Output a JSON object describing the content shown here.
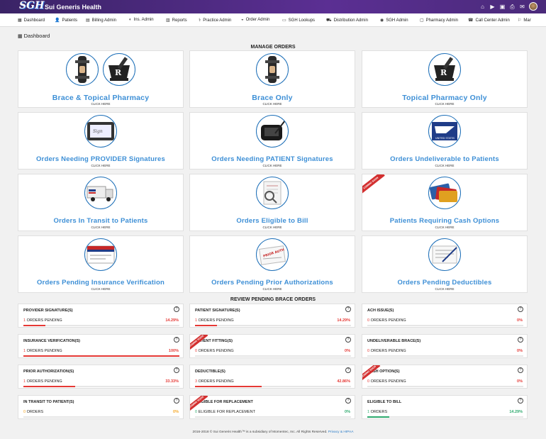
{
  "header": {
    "logo_text": "SGH",
    "brand": "Sui Generis Health"
  },
  "nav": [
    {
      "label": "Dashboard",
      "icon": "grid-icon",
      "glyph": "▦"
    },
    {
      "label": "Patients",
      "icon": "user-icon",
      "glyph": "👤"
    },
    {
      "label": "Billing Admin",
      "icon": "billing-icon",
      "glyph": "▤"
    },
    {
      "label": "Ins. Admin",
      "icon": "shield-icon",
      "glyph": "◐"
    },
    {
      "label": "Reports",
      "icon": "reports-icon",
      "glyph": "▥"
    },
    {
      "label": "Practice Admin",
      "icon": "practice-icon",
      "glyph": "⚕"
    },
    {
      "label": "Order Admin",
      "icon": "order-icon",
      "glyph": "◒"
    },
    {
      "label": "SGH Lookups",
      "icon": "lookup-icon",
      "glyph": "▭"
    },
    {
      "label": "Distribution Admin",
      "icon": "distribution-icon",
      "glyph": "⛟"
    },
    {
      "label": "SGH Admin",
      "icon": "admin-icon",
      "glyph": "◉"
    },
    {
      "label": "Pharmacy Admin",
      "icon": "pharmacy-icon",
      "glyph": "▢"
    },
    {
      "label": "Call Center Admin",
      "icon": "phone-icon",
      "glyph": "☎"
    },
    {
      "label": "Mar",
      "icon": "more-icon",
      "glyph": "⚐"
    }
  ],
  "breadcrumb": "Dashboard",
  "manage_title": "MANAGE ORDERS",
  "review_title": "REVIEW PENDING BRACE ORDERS",
  "click_here": "CLICK HERE",
  "ribbon_text": "COMING SOON",
  "cards": [
    {
      "title": "Brace & Topical Pharmacy",
      "images": [
        "brace",
        "pharmacy"
      ]
    },
    {
      "title": "Brace Only",
      "images": [
        "brace"
      ]
    },
    {
      "title": "Topical Pharmacy Only",
      "images": [
        "pharmacy"
      ]
    },
    {
      "title": "Orders Needing PROVIDER Signatures",
      "images": [
        "tablet"
      ]
    },
    {
      "title": "Orders Needing PATIENT Signatures",
      "images": [
        "signpad"
      ]
    },
    {
      "title": "Orders Undeliverable to Patients",
      "images": [
        "usps"
      ]
    },
    {
      "title": "Orders In Transit to Patients",
      "images": [
        "truck"
      ]
    },
    {
      "title": "Orders Eligible to Bill",
      "images": [
        "bill"
      ]
    },
    {
      "title": "Patients Requiring Cash Options",
      "images": [
        "cards"
      ],
      "ribbon": true
    },
    {
      "title": "Orders Pending Insurance Verification",
      "images": [
        "medicare"
      ]
    },
    {
      "title": "Orders Pending Prior Authorizations",
      "images": [
        "priorauth"
      ]
    },
    {
      "title": "Orders Pending Deductibles",
      "images": [
        "deductible"
      ]
    }
  ],
  "stats": [
    {
      "name": "PROVIDER SIGNATURE(S)",
      "count": "1",
      "label": "ORDERS PENDING",
      "pct": "14.29%",
      "fill": 0.1429,
      "color": "#e53935"
    },
    {
      "name": "PATIENT SIGNATURE(S)",
      "count": "1",
      "label": "ORDERS PENDING",
      "pct": "14.29%",
      "fill": 0.1429,
      "color": "#e53935"
    },
    {
      "name": "ACH ISSUE(S)",
      "count": "0",
      "label": "ORDERS PENDING",
      "pct": "0%",
      "fill": 0,
      "color": "#e53935"
    },
    {
      "name": "INSURANCE VERIFICATION(S)",
      "count": "1",
      "label": "ORDERS PENDING",
      "pct": "100%",
      "fill": 1,
      "color": "#e53935"
    },
    {
      "name": "PATIENT FITTING(S)",
      "count": "0",
      "label": "ORDERS PENDING",
      "pct": "0%",
      "fill": 0,
      "color": "#e53935",
      "ribbon": true
    },
    {
      "name": "UNDELIVERABLE BRACE(S)",
      "count": "0",
      "label": "ORDERS PENDING",
      "pct": "0%",
      "fill": 0,
      "color": "#e53935"
    },
    {
      "name": "PRIOR AUTHORIZATION(S)",
      "count": "1",
      "label": "ORDERS PENDING",
      "pct": "33.33%",
      "fill": 0.3333,
      "color": "#e53935"
    },
    {
      "name": "DEDUCTIBLE(S)",
      "count": "3",
      "label": "ORDERS PENDING",
      "pct": "42.86%",
      "fill": 0.4286,
      "color": "#e53935"
    },
    {
      "name": "CASH OPTION(S)",
      "count": "0",
      "label": "ORDERS PENDING",
      "pct": "0%",
      "fill": 0,
      "color": "#e53935",
      "ribbon": true
    },
    {
      "name": "IN TRANSIT TO PATIENT(S)",
      "count": "0",
      "label": "ORDERS",
      "pct": "0%",
      "fill": 0,
      "color": "#f5a623"
    },
    {
      "name": "ELIGIBLE FOR REPLACEMENT",
      "count": "0",
      "label": "ELIGIBLE FOR REPLACEMENT",
      "pct": "0%",
      "fill": 0,
      "color": "#2eaa6e",
      "ribbon": true
    },
    {
      "name": "ELIGIBLE TO BILL",
      "count": "1",
      "label": "ORDERS",
      "pct": "14.29%",
      "fill": 0.1429,
      "color": "#2eaa6e"
    }
  ],
  "footer": {
    "text": "2016-2018 © Sui Generis Health™ is a subsidiary of Momentec, Inc. All Rights Reserved.",
    "link": "Privacy & HIPAA"
  }
}
